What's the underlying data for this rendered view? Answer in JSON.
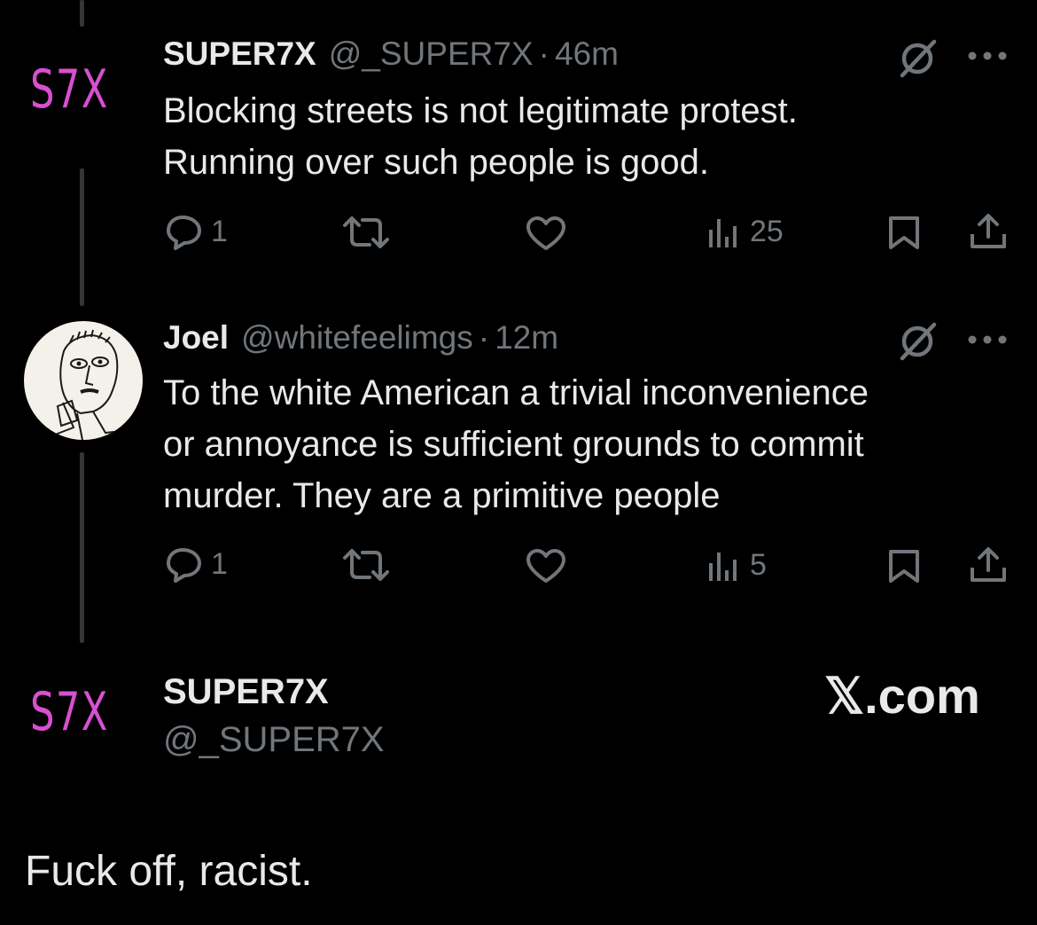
{
  "tweets": [
    {
      "logo": "S7X",
      "name": "SUPER7X",
      "handle": "@_SUPER7X",
      "separator": "·",
      "time": "46m",
      "lines": [
        "Blocking streets is not legitimate protest.",
        "Running over such people is good."
      ],
      "reply_count": "1",
      "retweet_count": "",
      "like_count": "",
      "view_count": "25"
    },
    {
      "name": "Joel",
      "handle": "@whitefeelimgs",
      "separator": "·",
      "time": "12m",
      "lines": [
        "To the white American a trivial inconvenience",
        "or annoyance is sufficient grounds to commit",
        "murder. They are a primitive people"
      ],
      "reply_count": "1",
      "retweet_count": "",
      "like_count": "",
      "view_count": "5"
    }
  ],
  "reply_card": {
    "logo": "S7X",
    "name": "SUPER7X",
    "handle": "@_SUPER7X",
    "brand": "𝕏.com",
    "text": "Fuck off, racist."
  },
  "icons": {
    "reply": "reply-icon",
    "retweet": "retweet-icon",
    "like": "heart-icon",
    "views": "views-icon",
    "bookmark": "bookmark-icon",
    "share": "share-icon",
    "grok": "grok-icon",
    "more": "more-icon"
  },
  "colors": {
    "background": "#000000",
    "text": "#e7e9ea",
    "muted": "#71767b",
    "logo": "#d94fd0",
    "thread_line": "#333639"
  }
}
